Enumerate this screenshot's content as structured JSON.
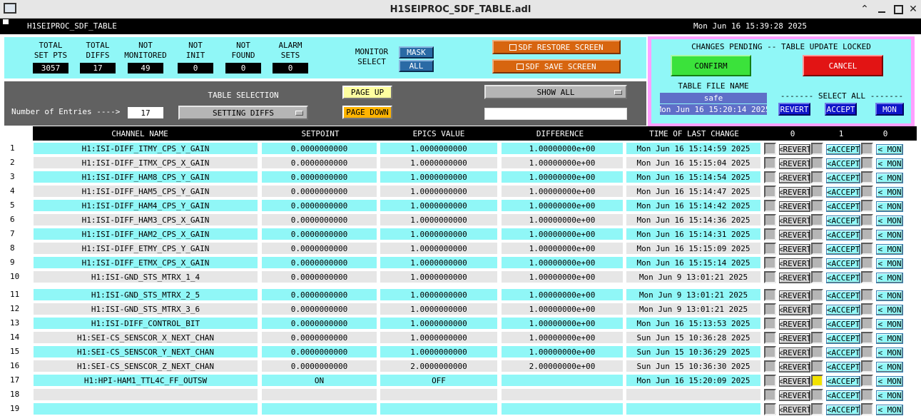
{
  "window": {
    "title": "H1SEIPROC_SDF_TABLE.adl",
    "minimize": "^",
    "maximize": "□",
    "close": "✕",
    "restore": "⌃"
  },
  "header": {
    "name": "H1SEIPROC_SDF_TABLE",
    "datetime": "Mon Jun 16 15:39:28 2025"
  },
  "stats": [
    {
      "label": "TOTAL\nSET PTS",
      "value": "3057"
    },
    {
      "label": "TOTAL\nDIFFS",
      "value": "17"
    },
    {
      "label": "NOT\nMONITORED",
      "value": "49"
    },
    {
      "label": "NOT\nINIT",
      "value": "0"
    },
    {
      "label": "NOT\nFOUND",
      "value": "0"
    },
    {
      "label": "ALARM\nSETS",
      "value": "0"
    }
  ],
  "monitor": {
    "label": "MONITOR\nSELECT",
    "mask": "MASK",
    "all": "ALL"
  },
  "screens": {
    "restore": "SDF RESTORE SCREEN",
    "save": "SDF SAVE SCREEN"
  },
  "selection": {
    "entries_label": "Number of Entries ---->",
    "entries_value": "17",
    "table_selection_label": "TABLE SELECTION",
    "table_selection_value": "SETTING DIFFS",
    "page_up": "PAGE UP",
    "page_down": "PAGE DOWN",
    "show_all": "SHOW ALL",
    "filter_text": ""
  },
  "pending": {
    "title": "CHANGES PENDING -- TABLE UPDATE LOCKED",
    "confirm": "CONFIRM",
    "cancel": "CANCEL",
    "file_label": "TABLE FILE NAME",
    "file_name": "safe",
    "file_time": "Mon Jun 16 15:20:14 2025",
    "select_all_label": "------- SELECT ALL -------",
    "revert": "REVERT",
    "accept": "ACCEPT",
    "mon": "MON"
  },
  "table": {
    "headers": [
      "CHANNEL NAME",
      "SETPOINT",
      "EPICS VALUE",
      "DIFFERENCE",
      "TIME OF LAST CHANGE"
    ],
    "counts": [
      "0",
      "1",
      "0"
    ],
    "revert_label": "<REVERT",
    "accept_label": "<ACCEPT",
    "mon_label": "< MON",
    "rows": [
      {
        "n": "1",
        "channel": "H1:ISI-DIFF_ITMY_CPS_Y_GAIN",
        "setpoint": "0.0000000000",
        "epics": "1.0000000000",
        "diff": "1.00000000e+00",
        "time": "Mon Jun 16 15:14:59 2025",
        "accept_checked": false
      },
      {
        "n": "2",
        "channel": "H1:ISI-DIFF_ITMX_CPS_X_GAIN",
        "setpoint": "0.0000000000",
        "epics": "1.0000000000",
        "diff": "1.00000000e+00",
        "time": "Mon Jun 16 15:15:04 2025",
        "accept_checked": false
      },
      {
        "n": "3",
        "channel": "H1:ISI-DIFF_HAM8_CPS_Y_GAIN",
        "setpoint": "0.0000000000",
        "epics": "1.0000000000",
        "diff": "1.00000000e+00",
        "time": "Mon Jun 16 15:14:54 2025",
        "accept_checked": false
      },
      {
        "n": "4",
        "channel": "H1:ISI-DIFF_HAM5_CPS_Y_GAIN",
        "setpoint": "0.0000000000",
        "epics": "1.0000000000",
        "diff": "1.00000000e+00",
        "time": "Mon Jun 16 15:14:47 2025",
        "accept_checked": false
      },
      {
        "n": "5",
        "channel": "H1:ISI-DIFF_HAM4_CPS_Y_GAIN",
        "setpoint": "0.0000000000",
        "epics": "1.0000000000",
        "diff": "1.00000000e+00",
        "time": "Mon Jun 16 15:14:42 2025",
        "accept_checked": false
      },
      {
        "n": "6",
        "channel": "H1:ISI-DIFF_HAM3_CPS_X_GAIN",
        "setpoint": "0.0000000000",
        "epics": "1.0000000000",
        "diff": "1.00000000e+00",
        "time": "Mon Jun 16 15:14:36 2025",
        "accept_checked": false
      },
      {
        "n": "7",
        "channel": "H1:ISI-DIFF_HAM2_CPS_X_GAIN",
        "setpoint": "0.0000000000",
        "epics": "1.0000000000",
        "diff": "1.00000000e+00",
        "time": "Mon Jun 16 15:14:31 2025",
        "accept_checked": false
      },
      {
        "n": "8",
        "channel": "H1:ISI-DIFF_ETMY_CPS_Y_GAIN",
        "setpoint": "0.0000000000",
        "epics": "1.0000000000",
        "diff": "1.00000000e+00",
        "time": "Mon Jun 16 15:15:09 2025",
        "accept_checked": false
      },
      {
        "n": "9",
        "channel": "H1:ISI-DIFF_ETMX_CPS_X_GAIN",
        "setpoint": "0.0000000000",
        "epics": "1.0000000000",
        "diff": "1.00000000e+00",
        "time": "Mon Jun 16 15:15:14 2025",
        "accept_checked": false
      },
      {
        "n": "10",
        "channel": "H1:ISI-GND_STS_MTRX_1_4",
        "setpoint": "0.0000000000",
        "epics": "1.0000000000",
        "diff": "1.00000000e+00",
        "time": "Mon Jun  9 13:01:21 2025",
        "accept_checked": false
      },
      {
        "n": "11",
        "channel": "H1:ISI-GND_STS_MTRX_2_5",
        "setpoint": "0.0000000000",
        "epics": "1.0000000000",
        "diff": "1.00000000e+00",
        "time": "Mon Jun  9 13:01:21 2025",
        "accept_checked": false
      },
      {
        "n": "12",
        "channel": "H1:ISI-GND_STS_MTRX_3_6",
        "setpoint": "0.0000000000",
        "epics": "1.0000000000",
        "diff": "1.00000000e+00",
        "time": "Mon Jun  9 13:01:21 2025",
        "accept_checked": false
      },
      {
        "n": "13",
        "channel": "H1:ISI-DIFF_CONTROL_BIT",
        "setpoint": "0.0000000000",
        "epics": "1.0000000000",
        "diff": "1.00000000e+00",
        "time": "Mon Jun 16 15:13:53 2025",
        "accept_checked": false
      },
      {
        "n": "14",
        "channel": "H1:SEI-CS_SENSCOR_X_NEXT_CHAN",
        "setpoint": "0.0000000000",
        "epics": "1.0000000000",
        "diff": "1.00000000e+00",
        "time": "Sun Jun 15 10:36:28 2025",
        "accept_checked": false
      },
      {
        "n": "15",
        "channel": "H1:SEI-CS_SENSCOR_Y_NEXT_CHAN",
        "setpoint": "0.0000000000",
        "epics": "1.0000000000",
        "diff": "1.00000000e+00",
        "time": "Sun Jun 15 10:36:29 2025",
        "accept_checked": false
      },
      {
        "n": "16",
        "channel": "H1:SEI-CS_SENSCOR_Z_NEXT_CHAN",
        "setpoint": "0.0000000000",
        "epics": "2.0000000000",
        "diff": "2.00000000e+00",
        "time": "Sun Jun 15 10:36:30 2025",
        "accept_checked": false
      },
      {
        "n": "17",
        "channel": "H1:HPI-HAM1_TTL4C_FF_OUTSW",
        "setpoint": "ON",
        "epics": "OFF",
        "diff": "",
        "time": "Mon Jun 16 15:20:09 2025",
        "accept_checked": true
      },
      {
        "n": "18",
        "channel": "",
        "setpoint": "",
        "epics": "",
        "diff": "",
        "time": "",
        "accept_checked": false
      },
      {
        "n": "19",
        "channel": "",
        "setpoint": "",
        "epics": "",
        "diff": "",
        "time": "",
        "accept_checked": false
      }
    ]
  },
  "colors": {
    "cyan": "#90f7f7",
    "grey": "#e6e6e6",
    "magenta": "#ff9fff",
    "orange": "#d7650f"
  }
}
